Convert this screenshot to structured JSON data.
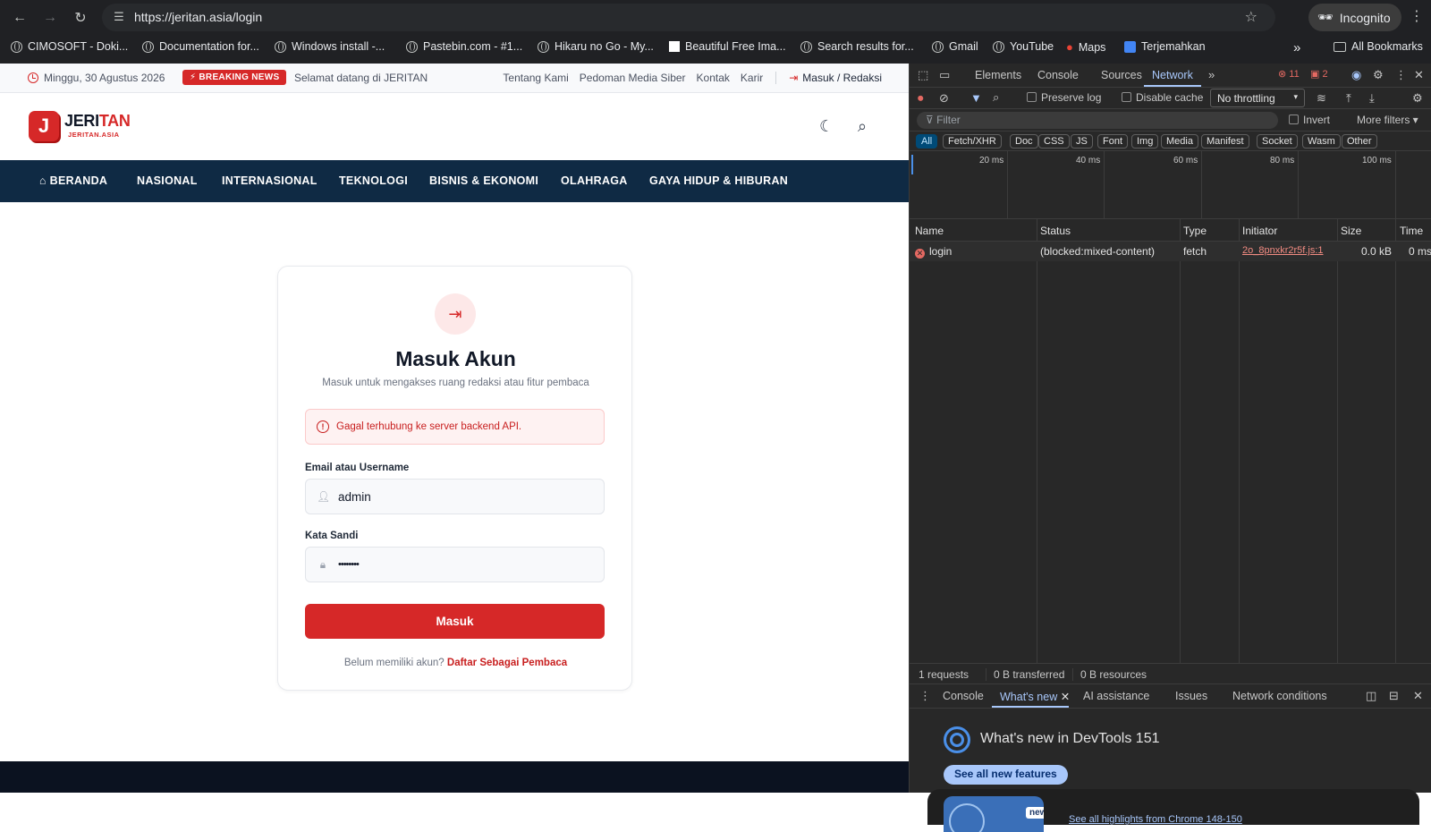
{
  "browser": {
    "url": "https://jeritan.asia/login",
    "incognito_label": "Incognito",
    "bookmarks": [
      "CIMOSOFT - Doki...",
      "Documentation for...",
      "Windows install -...",
      "Pastebin.com - #1...",
      "Hikaru no Go - My...",
      "Beautiful Free Ima...",
      "Search results for...",
      "Gmail",
      "YouTube",
      "Maps",
      "Terjemahkan"
    ],
    "all_bookmarks": "All Bookmarks"
  },
  "site": {
    "date": "Minggu, 30 Agustus 2026",
    "breaking": "BREAKING NEWS",
    "ticker": "Selamat datang di JERITAN",
    "top_links": [
      "Tentang Kami",
      "Pedoman Media Siber",
      "Kontak",
      "Karir"
    ],
    "login_link": "Masuk / Redaksi",
    "logo_letter": "J",
    "logo_main": "JERI",
    "logo_accent": "TAN",
    "logo_sub": "JERITAN.ASIA",
    "nav": [
      "BERANDA",
      "NASIONAL",
      "INTERNASIONAL",
      "TEKNOLOGI",
      "BISNIS & EKONOMI",
      "OLAHRAGA",
      "GAYA HIDUP & HIBURAN"
    ]
  },
  "login": {
    "title": "Masuk Akun",
    "subtitle": "Masuk untuk mengakses ruang redaksi atau fitur pembaca",
    "error": "Gagal terhubung ke server backend API.",
    "email_label": "Email atau Username",
    "email_value": "admin",
    "password_label": "Kata Sandi",
    "password_value": "••••••••",
    "submit": "Masuk",
    "register_prompt": "Belum memiliki akun?",
    "register_link": "Daftar Sebagai Pembaca"
  },
  "devtools": {
    "tabs": [
      "Elements",
      "Console",
      "Sources",
      "Network"
    ],
    "active_tab": "Network",
    "error_count": "11",
    "warn_count": "2",
    "preserve_log": "Preserve log",
    "disable_cache": "Disable cache",
    "throttling": "No throttling",
    "filter_placeholder": "Filter",
    "invert": "Invert",
    "more_filters": "More filters",
    "type_chips": [
      "All",
      "Fetch/XHR",
      "Doc",
      "CSS",
      "JS",
      "Font",
      "Img",
      "Media",
      "Manifest",
      "Socket",
      "Wasm",
      "Other"
    ],
    "timeline_labels": [
      "20 ms",
      "40 ms",
      "60 ms",
      "80 ms",
      "100 ms"
    ],
    "columns": [
      "Name",
      "Status",
      "Type",
      "Initiator",
      "Size",
      "Time"
    ],
    "requests": [
      {
        "name": "login",
        "status": "(blocked:mixed-content)",
        "type": "fetch",
        "initiator": "2o_8pnxkr2r5f.js:1",
        "size": "0.0 kB",
        "time": "0 ms"
      }
    ],
    "summary": [
      "1 requests",
      "0 B transferred",
      "0 B resources"
    ],
    "drawer_tabs": [
      "Console",
      "What's new",
      "AI assistance",
      "Issues",
      "Network conditions"
    ],
    "whats_new_title": "What's new in DevTools 151",
    "see_all": "See all new features",
    "badge_new": "new",
    "highlights_link": "See all highlights from Chrome 148-150"
  }
}
